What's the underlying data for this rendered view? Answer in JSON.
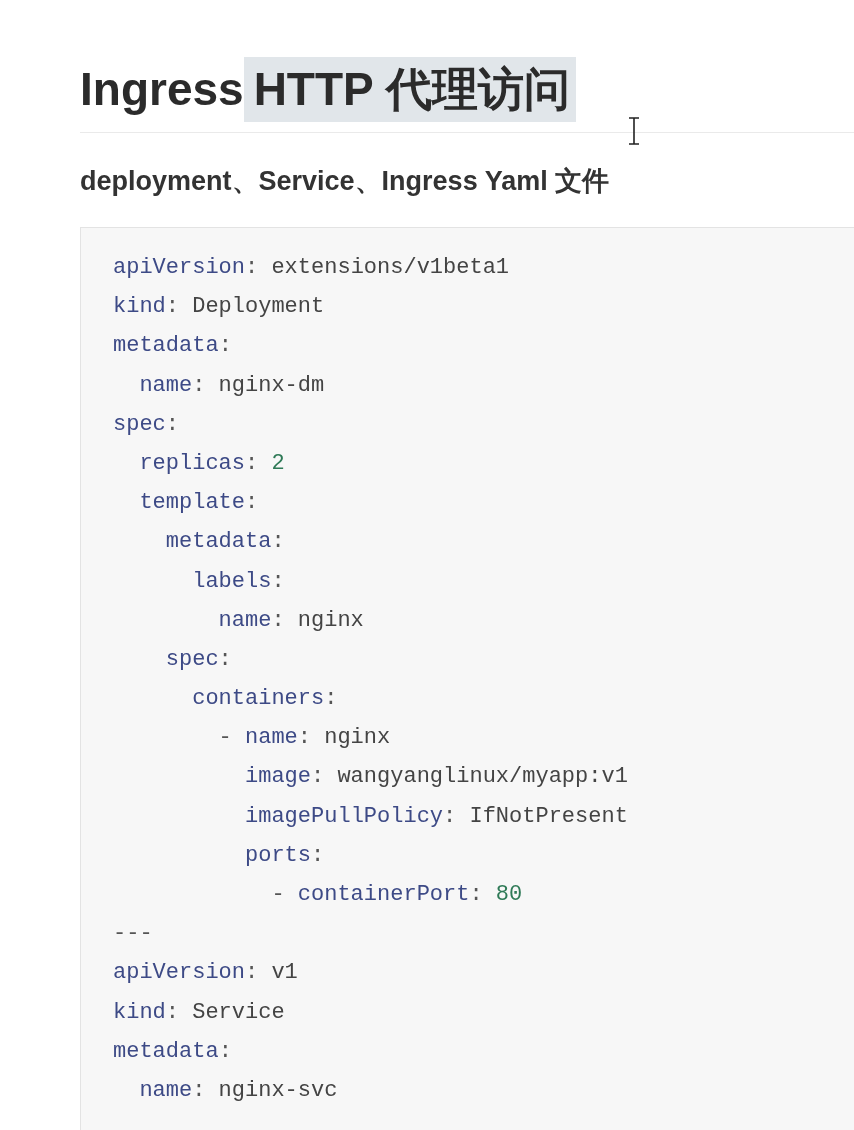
{
  "title": {
    "parts": [
      {
        "text": "Ingress",
        "highlighted": false
      },
      {
        "text": "HTTP 代理访问",
        "highlighted": true
      }
    ]
  },
  "subtitle": "deployment、Service、Ingress Yaml 文件",
  "code": [
    {
      "kind": "pair",
      "key": "apiVersion",
      "colon": ":",
      "value": {
        "kind": "string",
        "text": "extensions/v1beta1"
      }
    },
    {
      "kind": "pair",
      "key": "kind",
      "colon": ":",
      "value": {
        "kind": "string",
        "text": "Deployment"
      }
    },
    {
      "kind": "pair",
      "key": "metadata",
      "colon": ":",
      "children": [
        {
          "kind": "pair",
          "key": "name",
          "colon": ":",
          "value": {
            "kind": "string",
            "text": "nginx-dm"
          }
        }
      ]
    },
    {
      "kind": "pair",
      "key": "spec",
      "colon": ":",
      "children": [
        {
          "kind": "pair",
          "key": "replicas",
          "colon": ":",
          "value": {
            "kind": "number",
            "text": "2"
          }
        },
        {
          "kind": "pair",
          "key": "template",
          "colon": ":",
          "children": [
            {
              "kind": "pair",
              "key": "metadata",
              "colon": ":",
              "children": [
                {
                  "kind": "pair",
                  "key": "labels",
                  "colon": ":",
                  "children": [
                    {
                      "kind": "pair",
                      "key": "name",
                      "colon": ":",
                      "value": {
                        "kind": "string",
                        "text": "nginx"
                      }
                    }
                  ]
                }
              ]
            },
            {
              "kind": "pair",
              "key": "spec",
              "colon": ":",
              "children": [
                {
                  "kind": "pair",
                  "key": "containers",
                  "colon": ":",
                  "children": [
                    {
                      "kind": "list_item",
                      "dash": "-",
                      "children": [
                        {
                          "kind": "pair",
                          "key": "name",
                          "colon": ":",
                          "value": {
                            "kind": "string",
                            "text": "nginx"
                          }
                        },
                        {
                          "kind": "pair",
                          "key": "image",
                          "colon": ":",
                          "value": {
                            "kind": "string",
                            "text": "wangyanglinux/myapp:v1"
                          }
                        },
                        {
                          "kind": "pair",
                          "key": "imagePullPolicy",
                          "colon": ":",
                          "value": {
                            "kind": "string",
                            "text": "IfNotPresent"
                          }
                        },
                        {
                          "kind": "pair",
                          "key": "ports",
                          "colon": ":",
                          "children": [
                            {
                              "kind": "list_item",
                              "dash": "-",
                              "children": [
                                {
                                  "kind": "pair",
                                  "key": "containerPort",
                                  "colon": ":",
                                  "value": {
                                    "kind": "number",
                                    "text": "80"
                                  }
                                }
                              ]
                            }
                          ]
                        }
                      ]
                    }
                  ]
                }
              ]
            }
          ]
        }
      ]
    },
    {
      "kind": "separator",
      "text": "---"
    },
    {
      "kind": "pair",
      "key": "apiVersion",
      "colon": ":",
      "value": {
        "kind": "string",
        "text": "v1"
      }
    },
    {
      "kind": "pair",
      "key": "kind",
      "colon": ":",
      "value": {
        "kind": "string",
        "text": "Service"
      }
    },
    {
      "kind": "pair",
      "key": "metadata",
      "colon": ":",
      "children": [
        {
          "kind": "pair",
          "key": "name",
          "colon": ":",
          "value": {
            "kind": "string",
            "text": "nginx-svc"
          }
        }
      ]
    }
  ]
}
